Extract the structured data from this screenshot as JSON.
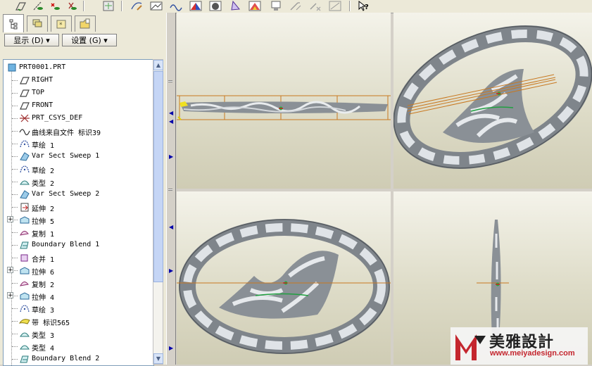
{
  "toolbar": {
    "icons": [
      "datum-plane-display-icon",
      "datum-axis-display-icon",
      "datum-point-display-icon",
      "coordinate-system-display-icon",
      "view-manager-icon",
      "sketch-tool-icon",
      "datum-plane-tool-icon",
      "datum-curve-tool-icon",
      "render-icon",
      "shade-icon",
      "analysis-icon",
      "color-appearance-icon",
      "saved-view-icon",
      "regenerate-icon",
      "delete-icon",
      "zoom-fit-icon",
      "whats-this-help-icon"
    ]
  },
  "left_panel": {
    "tabs": [
      "model-tree-tab-icon",
      "layer-tree-tab-icon",
      "favorites-tab-icon",
      "folder-browser-tab-icon"
    ],
    "show_dropdown": "显示 (D) ▾",
    "settings_dropdown": "设置 (G) ▾"
  },
  "model_tree": {
    "items": [
      {
        "label": "PRT0001.PRT",
        "icon": "part-icon",
        "expandable": false
      },
      {
        "label": "RIGHT",
        "icon": "datum-plane-icon",
        "expandable": false
      },
      {
        "label": "TOP",
        "icon": "datum-plane-icon",
        "expandable": false
      },
      {
        "label": "FRONT",
        "icon": "datum-plane-icon",
        "expandable": false
      },
      {
        "label": "PRT_CSYS_DEF",
        "icon": "coordinate-system-icon",
        "expandable": false
      },
      {
        "label": "曲线来自文件 标识39",
        "icon": "curve-icon",
        "expandable": false
      },
      {
        "label": "草绘 1",
        "icon": "sketch-icon",
        "expandable": false
      },
      {
        "label": "Var Sect Sweep 1",
        "icon": "var-sect-sweep-icon",
        "expandable": false
      },
      {
        "label": "草绘 2",
        "icon": "sketch-icon",
        "expandable": false
      },
      {
        "label": "类型 2",
        "icon": "surface-type-icon",
        "expandable": false
      },
      {
        "label": "Var Sect Sweep 2",
        "icon": "var-sect-sweep-icon",
        "expandable": false
      },
      {
        "label": "延伸 2",
        "icon": "extend-icon",
        "expandable": false
      },
      {
        "label": "拉伸 5",
        "icon": "extrude-icon",
        "expandable": true
      },
      {
        "label": "复制 1",
        "icon": "copy-icon",
        "expandable": false
      },
      {
        "label": "Boundary Blend 1",
        "icon": "boundary-blend-icon",
        "expandable": false
      },
      {
        "label": "合并 1",
        "icon": "merge-icon",
        "expandable": false
      },
      {
        "label": "拉伸 6",
        "icon": "extrude-icon",
        "expandable": true
      },
      {
        "label": "复制 2",
        "icon": "copy-icon",
        "expandable": false
      },
      {
        "label": "拉伸 4",
        "icon": "extrude-icon",
        "expandable": true
      },
      {
        "label": "草绘 3",
        "icon": "sketch-icon",
        "expandable": false
      },
      {
        "label": "带 标识565",
        "icon": "ribbon-icon",
        "expandable": false
      },
      {
        "label": "类型 3",
        "icon": "surface-type-icon",
        "expandable": false
      },
      {
        "label": "类型 4",
        "icon": "surface-type-icon",
        "expandable": false
      },
      {
        "label": "Boundary Blend 2",
        "icon": "boundary-blend-icon",
        "expandable": false
      }
    ]
  },
  "viewports": [
    {
      "name": "viewport-front-view"
    },
    {
      "name": "viewport-isometric-view"
    },
    {
      "name": "viewport-top-view"
    },
    {
      "name": "viewport-side-view"
    }
  ],
  "watermark": {
    "title": "美雅設計",
    "url": "www.meiyadesign.com"
  },
  "colors": {
    "tree_border": "#7f9db9",
    "datum_orange": "#c87820",
    "model_grey": "#7f858b",
    "model_light": "#dfe3e7",
    "viewport_bg": "#dedcc8",
    "brand_red": "#c4262e"
  }
}
